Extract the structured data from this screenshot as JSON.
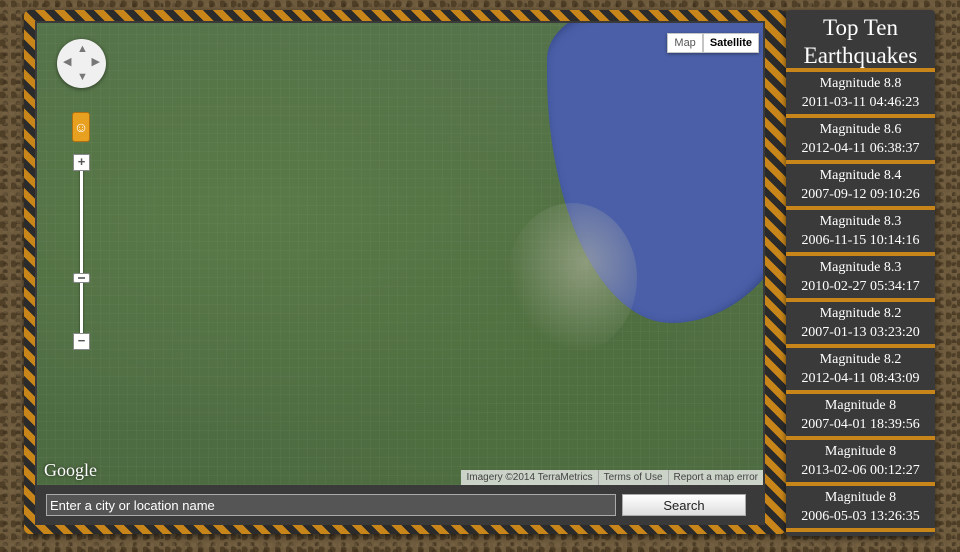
{
  "map": {
    "type_controls": [
      "Map",
      "Satellite"
    ],
    "active_type": "Satellite",
    "logo": "Google",
    "attribution": [
      "Imagery ©2014 TerraMetrics",
      "Terms of Use",
      "Report a map error"
    ],
    "zoom_in": "+",
    "zoom_out": "−"
  },
  "search": {
    "placeholder": "Enter a city or location name",
    "button_label": "Search"
  },
  "sidebar": {
    "title": "Top Ten Earthquakes",
    "quakes": [
      {
        "magnitude": "Magnitude 8.8",
        "datetime": "2011-03-11 04:46:23"
      },
      {
        "magnitude": "Magnitude 8.6",
        "datetime": "2012-04-11 06:38:37"
      },
      {
        "magnitude": "Magnitude 8.4",
        "datetime": "2007-09-12 09:10:26"
      },
      {
        "magnitude": "Magnitude 8.3",
        "datetime": "2006-11-15 10:14:16"
      },
      {
        "magnitude": "Magnitude 8.3",
        "datetime": "2010-02-27 05:34:17"
      },
      {
        "magnitude": "Magnitude 8.2",
        "datetime": "2007-01-13 03:23:20"
      },
      {
        "magnitude": "Magnitude 8.2",
        "datetime": "2012-04-11 08:43:09"
      },
      {
        "magnitude": "Magnitude 8",
        "datetime": "2007-04-01 18:39:56"
      },
      {
        "magnitude": "Magnitude 8",
        "datetime": "2013-02-06 00:12:27"
      },
      {
        "magnitude": "Magnitude 8",
        "datetime": "2006-05-03 13:26:35"
      }
    ]
  },
  "colors": {
    "stripe": "#c8861a",
    "panel": "#3a3a3a",
    "lake": "#4a5fa8"
  }
}
